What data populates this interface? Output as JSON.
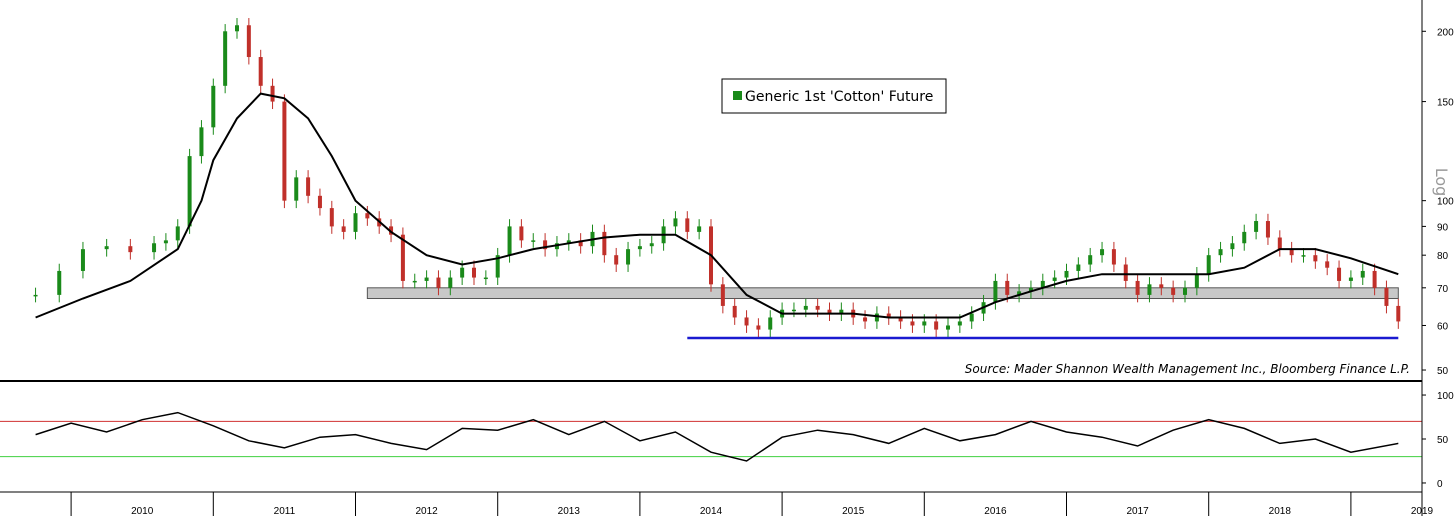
{
  "chart_data": [
    {
      "type": "line",
      "name": "price-panel",
      "series": [
        {
          "name": "Generic 1st 'Cotton' Future",
          "style": "candlestick",
          "color_up": "#1a8a1a",
          "color_down": "#c0302a",
          "x": [
            "2009-10",
            "2009-12",
            "2010-02",
            "2010-04",
            "2010-06",
            "2010-08",
            "2010-09",
            "2010-10",
            "2010-11",
            "2010-12",
            "2011-01",
            "2011-02",
            "2011-03",
            "2011-04",
            "2011-05",
            "2011-06",
            "2011-07",
            "2011-08",
            "2011-09",
            "2011-10",
            "2011-11",
            "2011-12",
            "2012-01",
            "2012-02",
            "2012-03",
            "2012-04",
            "2012-05",
            "2012-06",
            "2012-07",
            "2012-08",
            "2012-09",
            "2012-10",
            "2012-11",
            "2012-12",
            "2013-01",
            "2013-02",
            "2013-03",
            "2013-04",
            "2013-05",
            "2013-06",
            "2013-07",
            "2013-08",
            "2013-09",
            "2013-10",
            "2013-11",
            "2013-12",
            "2014-01",
            "2014-02",
            "2014-03",
            "2014-04",
            "2014-05",
            "2014-06",
            "2014-07",
            "2014-08",
            "2014-09",
            "2014-10",
            "2014-11",
            "2014-12",
            "2015-01",
            "2015-02",
            "2015-03",
            "2015-04",
            "2015-05",
            "2015-06",
            "2015-07",
            "2015-08",
            "2015-09",
            "2015-10",
            "2015-11",
            "2015-12",
            "2016-01",
            "2016-02",
            "2016-03",
            "2016-04",
            "2016-05",
            "2016-06",
            "2016-07",
            "2016-08",
            "2016-09",
            "2016-10",
            "2016-11",
            "2016-12",
            "2017-01",
            "2017-02",
            "2017-03",
            "2017-04",
            "2017-05",
            "2017-06",
            "2017-07",
            "2017-08",
            "2017-09",
            "2017-10",
            "2017-11",
            "2017-12",
            "2018-01",
            "2018-02",
            "2018-03",
            "2018-04",
            "2018-05",
            "2018-06",
            "2018-07",
            "2018-08",
            "2018-09",
            "2018-10",
            "2018-11",
            "2018-12",
            "2019-01",
            "2019-02",
            "2019-03",
            "2019-04",
            "2019-05"
          ],
          "values": [
            68,
            75,
            82,
            83,
            81,
            84,
            85,
            90,
            120,
            135,
            160,
            200,
            205,
            180,
            160,
            150,
            100,
            110,
            102,
            97,
            90,
            88,
            95,
            93,
            90,
            87,
            72,
            72,
            73,
            70,
            73,
            76,
            73,
            73,
            80,
            90,
            85,
            85,
            82,
            84,
            85,
            83,
            88,
            80,
            77,
            82,
            83,
            84,
            90,
            93,
            88,
            90,
            71,
            65,
            62,
            60,
            59,
            62,
            64,
            64,
            65,
            64,
            63,
            64,
            62,
            61,
            63,
            62,
            61,
            60,
            61,
            59,
            60,
            61,
            63,
            66,
            72,
            68,
            69,
            70,
            72,
            73,
            75,
            77,
            80,
            82,
            77,
            72,
            68,
            71,
            70,
            68,
            70,
            74,
            80,
            82,
            84,
            88,
            92,
            86,
            82,
            80,
            80,
            78,
            76,
            72,
            73,
            75,
            70,
            65,
            61
          ]
        },
        {
          "name": "moving-average",
          "color": "#000000",
          "x": [
            "2009-10",
            "2010-02",
            "2010-06",
            "2010-10",
            "2010-12",
            "2011-01",
            "2011-03",
            "2011-05",
            "2011-07",
            "2011-09",
            "2011-11",
            "2012-01",
            "2012-04",
            "2012-07",
            "2012-10",
            "2013-01",
            "2013-04",
            "2013-07",
            "2013-10",
            "2014-01",
            "2014-04",
            "2014-07",
            "2014-10",
            "2015-01",
            "2015-04",
            "2015-07",
            "2015-10",
            "2016-01",
            "2016-04",
            "2016-07",
            "2016-10",
            "2017-01",
            "2017-04",
            "2017-07",
            "2017-10",
            "2018-01",
            "2018-04",
            "2018-07",
            "2018-10",
            "2019-01",
            "2019-05"
          ],
          "values": [
            62,
            67,
            72,
            82,
            100,
            118,
            140,
            155,
            152,
            140,
            120,
            100,
            88,
            80,
            77,
            79,
            82,
            84,
            86,
            87,
            87,
            80,
            68,
            63,
            63,
            63,
            62,
            62,
            62,
            66,
            69,
            72,
            74,
            74,
            74,
            74,
            76,
            82,
            82,
            79,
            74
          ]
        }
      ],
      "y_scale": "log",
      "ylim": [
        48,
        220
      ],
      "yticks": [
        50,
        60,
        70,
        80,
        90,
        100,
        150,
        200
      ],
      "scale_label": "Log",
      "annotations": {
        "support_band": {
          "from": 67,
          "to": 70,
          "start": "2012-02",
          "end": "2019-05",
          "color": "#c8c8c8"
        },
        "support_line": {
          "value": 57,
          "start": "2014-05",
          "end": "2019-05",
          "color": "#1a1ad0"
        }
      },
      "legend": {
        "position": "top-center",
        "label": "Generic 1st 'Cotton' Future",
        "color": "#1a8a1a"
      },
      "source": "Source: Mader Shannon Wealth Management Inc., Bloomberg Finance L.P."
    },
    {
      "type": "line",
      "name": "oscillator-panel",
      "series": [
        {
          "name": "",
          "color": "#000000",
          "x": [
            "2009-10",
            "2010-01",
            "2010-04",
            "2010-07",
            "2010-10",
            "2011-01",
            "2011-04",
            "2011-07",
            "2011-10",
            "2012-01",
            "2012-04",
            "2012-07",
            "2012-10",
            "2013-01",
            "2013-04",
            "2013-07",
            "2013-10",
            "2014-01",
            "2014-04",
            "2014-07",
            "2014-10",
            "2015-01",
            "2015-04",
            "2015-07",
            "2015-10",
            "2016-01",
            "2016-04",
            "2016-07",
            "2016-10",
            "2017-01",
            "2017-04",
            "2017-07",
            "2017-10",
            "2018-01",
            "2018-04",
            "2018-07",
            "2018-10",
            "2019-01",
            "2019-05"
          ],
          "values": [
            55,
            68,
            58,
            72,
            80,
            65,
            48,
            40,
            52,
            55,
            45,
            38,
            62,
            60,
            72,
            55,
            70,
            48,
            58,
            35,
            25,
            52,
            60,
            55,
            45,
            62,
            48,
            55,
            70,
            58,
            52,
            42,
            60,
            72,
            62,
            45,
            50,
            35,
            45
          ]
        }
      ],
      "ylim": [
        -8,
        108
      ],
      "yticks": [
        0,
        50,
        100
      ],
      "reference_lines": [
        {
          "value": 70,
          "color": "#d03030"
        },
        {
          "value": 30,
          "color": "#40d040"
        }
      ]
    }
  ],
  "x_axis": {
    "labels": [
      "2010",
      "2011",
      "2012",
      "2013",
      "2014",
      "2015",
      "2016",
      "2017",
      "2018",
      "2019"
    ]
  }
}
